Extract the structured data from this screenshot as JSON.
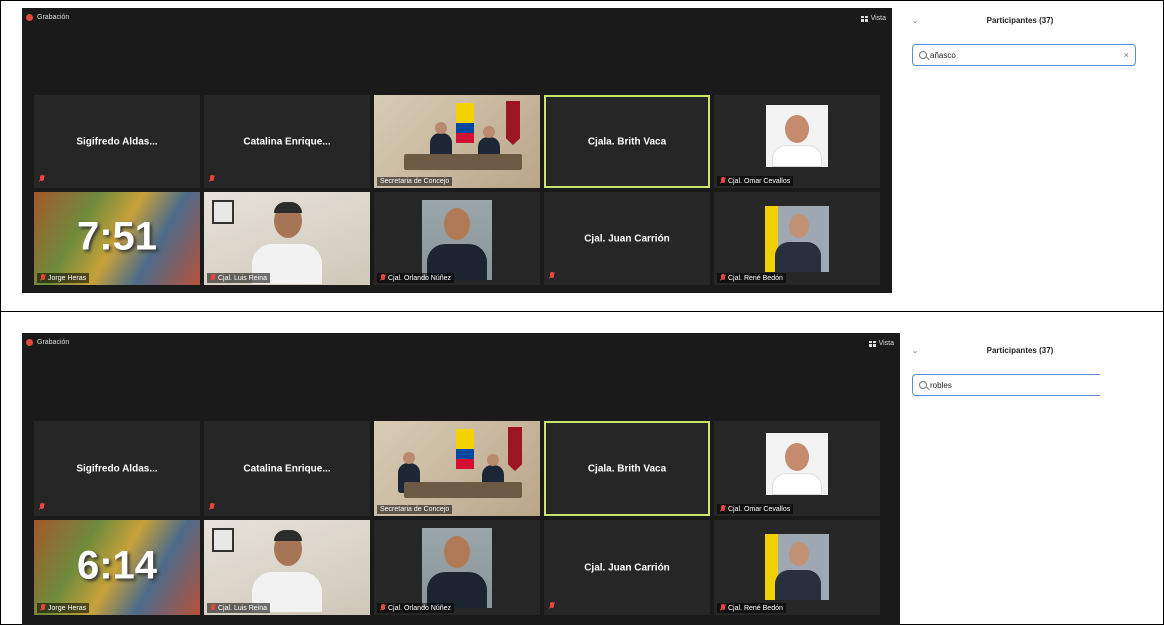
{
  "screens": [
    {
      "recording_label": "Grabación",
      "view_label": "Vista",
      "timer": "7:51",
      "participants_title": "Participantes (37)",
      "search_value": "añasco",
      "clear_symbol": "×"
    },
    {
      "recording_label": "Grabación",
      "view_label": "Vista",
      "timer": "6:14",
      "participants_title": "Participantes (37)",
      "search_value": "robles",
      "clear_symbol": ""
    }
  ],
  "tiles": {
    "sigifredo": "Sigifredo  Aldas...",
    "catalina": "Catalina  Enrique...",
    "secretaria": "Secretaria de Concejo",
    "brith": "Cjala. Brith Vaca",
    "omar": "Cjal. Omar Cevallos",
    "jorge": "Jorge Heras",
    "luis": "Cjal. Luis Reina",
    "orlando": "Cjal. Orlando Núñez",
    "juan": "Cjal. Juan Carrión",
    "rene": "Cjal. René Bedón"
  },
  "colors": {
    "meeting_bg": "#1a1a1a",
    "tile_bg": "#262626",
    "active_border": "#c9e46a",
    "muted_red": "#e6473b",
    "search_border": "#5b8dd8"
  },
  "icons": [
    "record-dot-icon",
    "grid-view-icon",
    "muted-mic-icon",
    "search-icon",
    "chevron-down-icon",
    "close-icon"
  ]
}
